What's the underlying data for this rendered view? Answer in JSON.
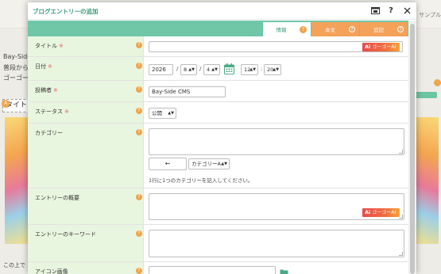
{
  "background": {
    "topbar_right": "サンプル",
    "lines": [
      "Bay-Side",
      "普段から",
      "ゴーゴー"
    ],
    "title_text": "タイト",
    "bottom_text": "この上で",
    "badge_letter": "A"
  },
  "modal": {
    "title": "ブログエントリーの追加",
    "header_icons": [
      "preview-icon",
      "help-icon",
      "close-icon"
    ]
  },
  "tabs": [
    {
      "label": "情報",
      "active": true
    },
    {
      "label": "本文",
      "active": false
    },
    {
      "label": "追記",
      "active": false
    }
  ],
  "help_glyph": "?",
  "required_mark": "※",
  "ai_button": {
    "logo": "Ai",
    "label": "ゴーゴーAI"
  },
  "fields": {
    "title": {
      "label": "タイトル",
      "value": ""
    },
    "date": {
      "label": "日付",
      "year": "2026",
      "month": "8",
      "day": "4",
      "hour": "12",
      "minute": "20",
      "date_sep": "/",
      "time_sep": ":"
    },
    "author": {
      "label": "投稿者",
      "value": "Bay-Side CMS"
    },
    "status": {
      "label": "ステータス",
      "value": "公開"
    },
    "category": {
      "label": "カテゴリー",
      "back_button": "←",
      "select_value": "カテゴリーA",
      "hint": "1行に1つのカテゴリーを記入してください。"
    },
    "summary": {
      "label": "エントリーの概要",
      "value": ""
    },
    "keywords": {
      "label": "エントリーのキーワード",
      "value": ""
    },
    "icon_image": {
      "label": "アイコン画像",
      "value": ""
    }
  },
  "colors": {
    "tab_bar": "#6fc7a8",
    "tab_orange": "#f4a15a",
    "label_bg": "#e9f6df",
    "accent_green": "#3a9a7a",
    "help_orange": "#f0a34a",
    "required_red": "#e07070"
  }
}
